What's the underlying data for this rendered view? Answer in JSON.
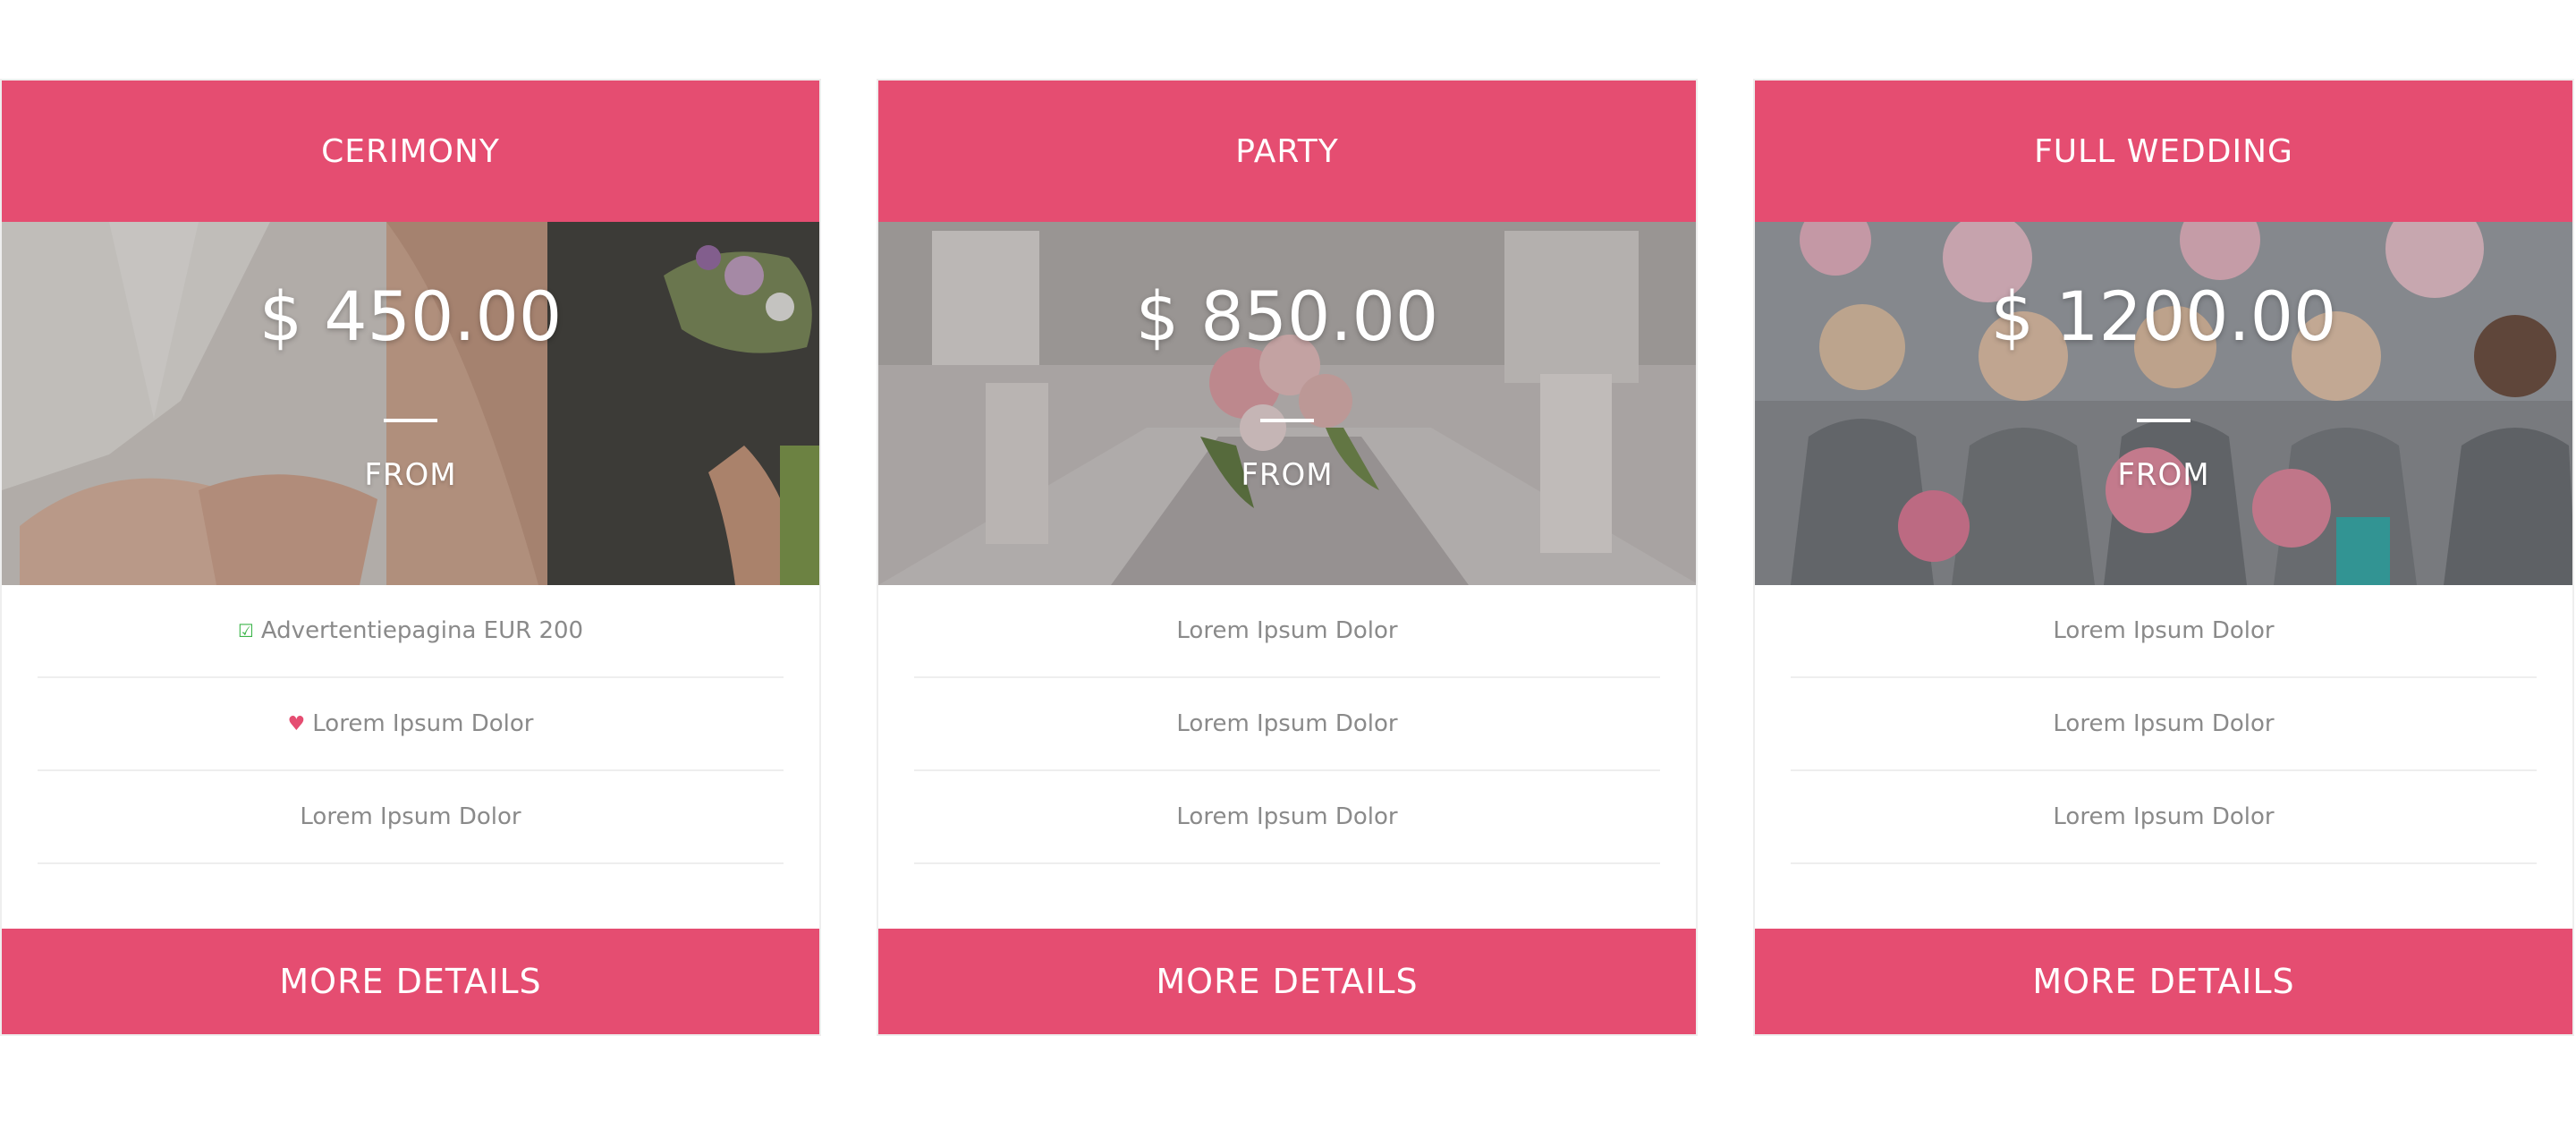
{
  "colors": {
    "accent": "#e54d71",
    "text_muted": "#8a8a8a",
    "divider": "#eeeeee",
    "check": "#3cb54a"
  },
  "plans": [
    {
      "title": "CERIMONY",
      "price": "$ 450.00",
      "from_label": "FROM",
      "features": [
        {
          "icon": "checkbox-icon",
          "text": "Advertentiepagina EUR 200"
        },
        {
          "icon": "heart-icon",
          "text": "Lorem Ipsum Dolor"
        },
        {
          "icon": "",
          "text": "Lorem Ipsum Dolor"
        }
      ],
      "button_label": "MORE DETAILS"
    },
    {
      "title": "PARTY",
      "price": "$ 850.00",
      "from_label": "FROM",
      "features": [
        {
          "icon": "",
          "text": "Lorem Ipsum Dolor"
        },
        {
          "icon": "",
          "text": "Lorem Ipsum Dolor"
        },
        {
          "icon": "",
          "text": "Lorem Ipsum Dolor"
        }
      ],
      "button_label": "MORE DETAILS"
    },
    {
      "title": "FULL WEDDING",
      "price": "$ 1200.00",
      "from_label": "FROM",
      "features": [
        {
          "icon": "",
          "text": "Lorem Ipsum Dolor"
        },
        {
          "icon": "",
          "text": "Lorem Ipsum Dolor"
        },
        {
          "icon": "",
          "text": "Lorem Ipsum Dolor"
        }
      ],
      "button_label": "MORE DETAILS"
    }
  ]
}
